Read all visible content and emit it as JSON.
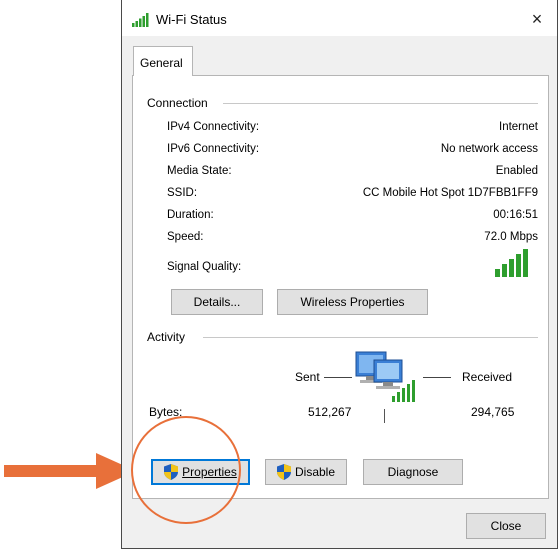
{
  "window": {
    "title": "Wi-Fi Status",
    "close_glyph": "×"
  },
  "tabs": [
    {
      "label": "General"
    }
  ],
  "connection": {
    "group_label": "Connection",
    "rows": [
      {
        "label": "IPv4 Connectivity:",
        "value": "Internet"
      },
      {
        "label": "IPv6 Connectivity:",
        "value": "No network access"
      },
      {
        "label": "Media State:",
        "value": "Enabled"
      },
      {
        "label": "SSID:",
        "value": "CC Mobile Hot Spot 1D7FBB1FF9"
      },
      {
        "label": "Duration:",
        "value": "00:16:51"
      },
      {
        "label": "Speed:",
        "value": "72.0 Mbps"
      }
    ],
    "signal_label": "Signal Quality:",
    "signal_bars": 5,
    "details_button": "Details...",
    "details_mnemonic": "e",
    "wireless_button": "Wireless Properties",
    "wireless_mnemonic": "W"
  },
  "activity": {
    "group_label": "Activity",
    "sent_label": "Sent",
    "received_label": "Received",
    "bytes_label": "Bytes:",
    "bytes_sent": "512,267",
    "bytes_received": "294,765"
  },
  "buttons": {
    "properties": "Properties",
    "properties_mnemonic": "P",
    "disable": "Disable",
    "disable_mnemonic": "D",
    "diagnose": "Diagnose",
    "close": "Close",
    "close_mnemonic": "C"
  },
  "annotation": {
    "color": "#e8703a",
    "icon": "arrow-right-icon"
  },
  "colors": {
    "accent": "#0078d7",
    "signal": "#2e9e2e"
  }
}
